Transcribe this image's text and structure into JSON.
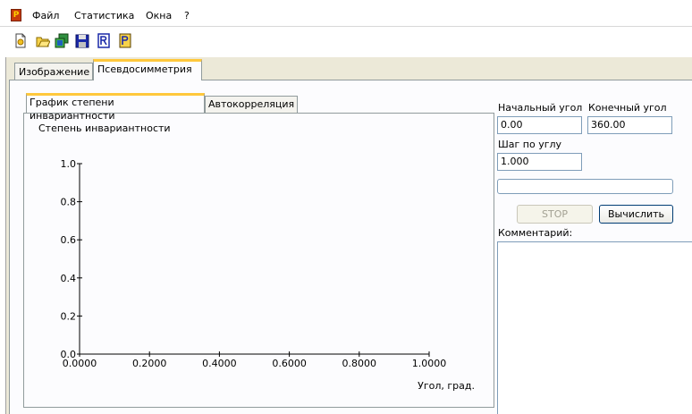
{
  "menu": {
    "app_icon_letter": "P",
    "items": [
      "Файл",
      "Статистика",
      "Окна",
      "?"
    ]
  },
  "toolbar": {
    "icons": [
      "new-document-icon",
      "open-folder-icon",
      "copy-images-icon",
      "save-icon",
      "report-icon",
      "export-icon"
    ]
  },
  "main_tabs": [
    "Изображение",
    "Псевдосимметрия"
  ],
  "sub_tabs": [
    "График степени инвариантности",
    "Автокорреляция"
  ],
  "chart_data": {
    "type": "line",
    "title": "Степень инвариантности",
    "xlabel": "Угол, град.",
    "ylabel": "",
    "x_ticks": [
      "0.0000",
      "0.2000",
      "0.4000",
      "0.6000",
      "0.8000",
      "1.0000"
    ],
    "y_ticks": [
      "0.0",
      "0.2",
      "0.4",
      "0.6",
      "0.8",
      "1.0"
    ],
    "xlim": [
      0,
      1
    ],
    "ylim": [
      0,
      1
    ],
    "series": []
  },
  "params": {
    "start_angle_label": "Начальный угол",
    "start_angle_value": "0.00",
    "end_angle_label": "Конечный угол",
    "end_angle_value": "360.00",
    "step_label": "Шаг по углу",
    "step_value": "1.000",
    "progress": 0
  },
  "buttons": {
    "stop": "STOP",
    "compute": "Вычислить"
  },
  "comment": {
    "label": "Комментарий:",
    "value": ""
  }
}
